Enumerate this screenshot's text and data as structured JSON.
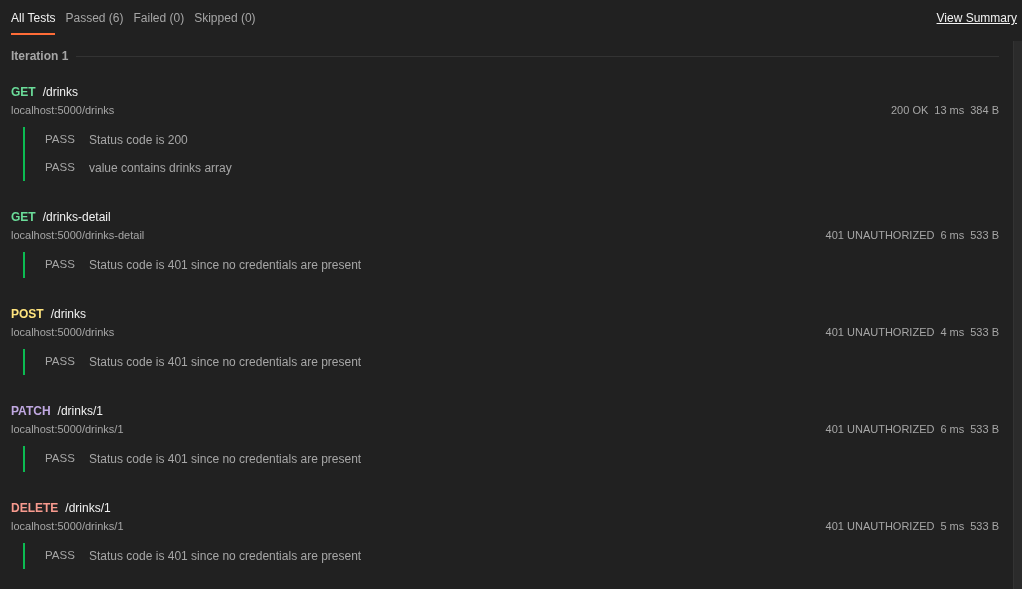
{
  "tabs": [
    {
      "label": "All Tests",
      "selected": true
    },
    {
      "label": "Passed (6)",
      "selected": false
    },
    {
      "label": "Failed (0)",
      "selected": false
    },
    {
      "label": "Skipped (0)",
      "selected": false
    }
  ],
  "view_summary": "View Summary",
  "iteration": "Iteration 1",
  "requests": [
    {
      "method": "GET",
      "color": "#6bdd9a",
      "path": "/drinks",
      "url": "localhost:5000/drinks",
      "status": "200 OK",
      "time": "13 ms",
      "size": "384 B",
      "tests": [
        {
          "result": "PASS",
          "name": "Status code is 200"
        },
        {
          "result": "PASS",
          "name": "value contains drinks array"
        }
      ]
    },
    {
      "method": "GET",
      "color": "#6bdd9a",
      "path": "/drinks-detail",
      "url": "localhost:5000/drinks-detail",
      "status": "401 UNAUTHORIZED",
      "time": "6 ms",
      "size": "533 B",
      "tests": [
        {
          "result": "PASS",
          "name": "Status code is 401 since no credentials are present"
        }
      ]
    },
    {
      "method": "POST",
      "color": "#ffe47e",
      "path": "/drinks",
      "url": "localhost:5000/drinks",
      "status": "401 UNAUTHORIZED",
      "time": "4 ms",
      "size": "533 B",
      "tests": [
        {
          "result": "PASS",
          "name": "Status code is 401 since no credentials are present"
        }
      ]
    },
    {
      "method": "PATCH",
      "color": "#c0a8e1",
      "path": "/drinks/1",
      "url": "localhost:5000/drinks/1",
      "status": "401 UNAUTHORIZED",
      "time": "6 ms",
      "size": "533 B",
      "tests": [
        {
          "result": "PASS",
          "name": "Status code is 401 since no credentials are present"
        }
      ]
    },
    {
      "method": "DELETE",
      "color": "#f79a8e",
      "path": "/drinks/1",
      "url": "localhost:5000/drinks/1",
      "status": "401 UNAUTHORIZED",
      "time": "5 ms",
      "size": "533 B",
      "tests": [
        {
          "result": "PASS",
          "name": "Status code is 401 since no credentials are present"
        }
      ]
    }
  ]
}
